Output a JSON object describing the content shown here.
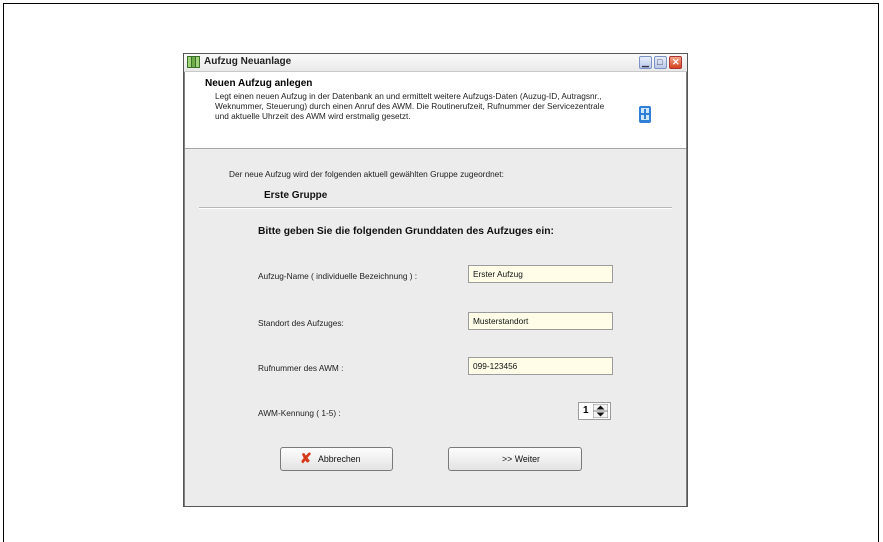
{
  "window": {
    "title": "Aufzug Neuanlage"
  },
  "header": {
    "title": "Neuen Aufzug anlegen",
    "description": "Legt einen neuen Aufzug in der Datenbank an und ermittelt  weitere Aufzugs-Daten (Auzug-ID, Autragsnr., Weknummer, Steuerung) durch einen Anruf des AWM. Die Routinerufzeit, Rufnummer der Servicezentrale und aktuelle Uhrzeit des AWM wird erstmalig gesetzt."
  },
  "group": {
    "intro": "Der neue Aufzug wird der folgenden aktuell gewählten Gruppe zugeordnet:",
    "name": "Erste Gruppe"
  },
  "form": {
    "heading": "Bitte geben Sie die folgenden Grunddaten des Aufzuges ein:",
    "name_label": "Aufzug-Name ( individuelle Bezeichnung ) :",
    "name_value": "Erster Aufzug",
    "location_label": "Standort des Aufzuges:",
    "location_value": "Musterstandort",
    "phone_label": "Rufnummer des AWM :",
    "phone_value": "099-123456",
    "id_label": "AWM-Kennung  ( 1-5) :",
    "id_value": "1"
  },
  "buttons": {
    "cancel_label": "Abbrechen",
    "next_label": ">>  Weiter"
  },
  "colors": {
    "field_background": "#fffde8",
    "dialog_background": "#ececec",
    "cancel_icon": "#d43a1a"
  }
}
